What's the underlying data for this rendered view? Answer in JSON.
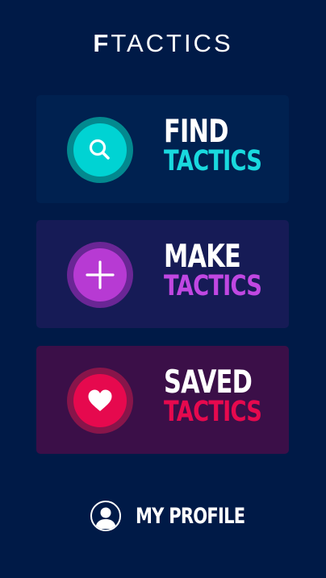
{
  "app": {
    "logo_first": "F",
    "logo_rest": "TACTICS"
  },
  "menu": {
    "find": {
      "line1": "FIND",
      "line2": "TACTICS",
      "icon": "search-icon",
      "accent": "#00d3d3"
    },
    "make": {
      "line1": "MAKE",
      "line2": "TACTICS",
      "icon": "plus-icon",
      "accent": "#b73ad3"
    },
    "saved": {
      "line1": "SAVED",
      "line2": "TACTICS",
      "icon": "heart-icon",
      "accent": "#e6094e"
    }
  },
  "profile": {
    "label": "MY PROFILE",
    "icon": "user-icon"
  },
  "colors": {
    "background": "#001a47",
    "text": "#ffffff"
  }
}
